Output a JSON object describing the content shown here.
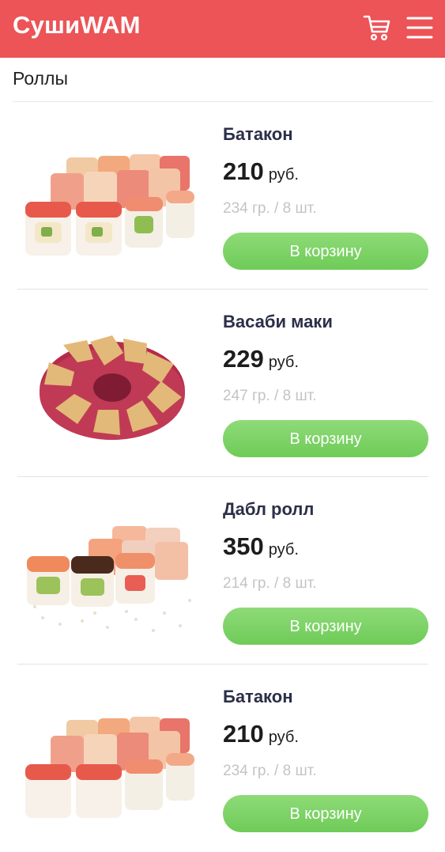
{
  "header": {
    "brand": "СушиWAM",
    "cart_icon": "cart-icon",
    "menu_icon": "hamburger-menu-icon",
    "background": "#ec5457"
  },
  "section": {
    "title": "Роллы"
  },
  "products": [
    {
      "name": "Батакон",
      "price": "210",
      "currency": "руб.",
      "weight": "234 гр. / 8 шт.",
      "button": "В корзину"
    },
    {
      "name": "Васаби маки",
      "price": "229",
      "currency": "руб.",
      "weight": "247 гр. / 8 шт.",
      "button": "В корзину"
    },
    {
      "name": "Дабл ролл",
      "price": "350",
      "currency": "руб.",
      "weight": "214 гр. / 8 шт.",
      "button": "В корзину"
    },
    {
      "name": "Батакон",
      "price": "210",
      "currency": "руб.",
      "weight": "234 гр. / 8 шт.",
      "button": "В корзину"
    }
  ],
  "colors": {
    "accent": "#ec5457",
    "button": "#7bd163",
    "title_text": "#2b2f48",
    "muted_text": "#c4c4c4"
  }
}
